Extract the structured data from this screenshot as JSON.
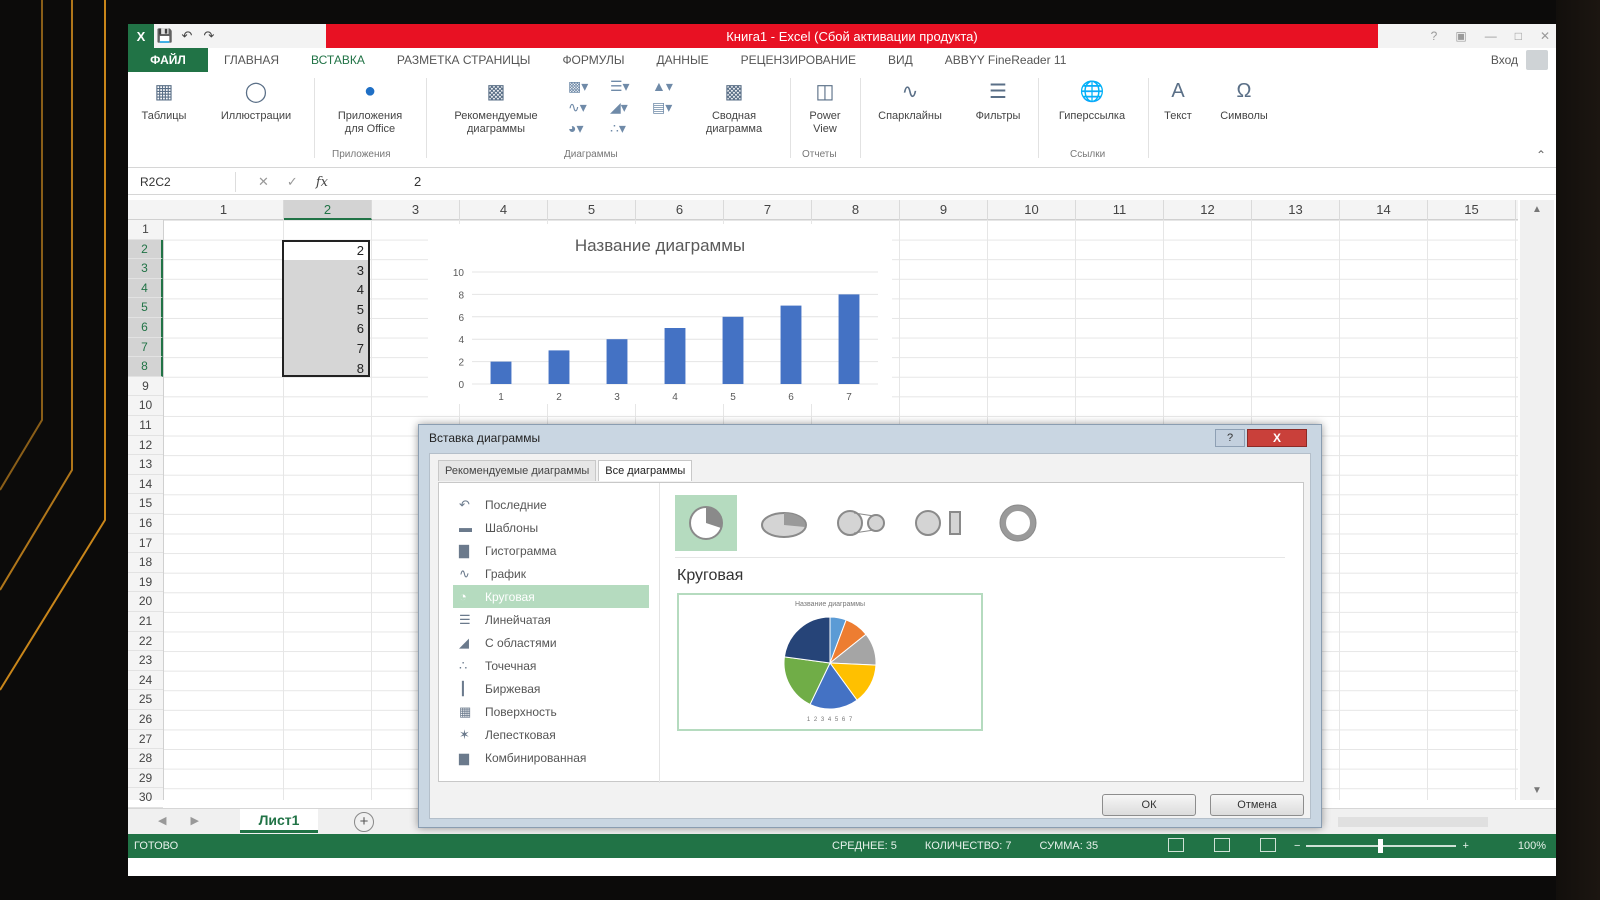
{
  "window": {
    "title": "Книга1 - Excel (Сбой активации продукта)",
    "app_icon": "X"
  },
  "ribbon_tabs": [
    {
      "label": "ФАЙЛ"
    },
    {
      "label": "ГЛАВНАЯ"
    },
    {
      "label": "ВСТАВКА"
    },
    {
      "label": "РАЗМЕТКА СТРАНИЦЫ"
    },
    {
      "label": "ФОРМУЛЫ"
    },
    {
      "label": "ДАННЫЕ"
    },
    {
      "label": "РЕЦЕНЗИРОВАНИЕ"
    },
    {
      "label": "ВИД"
    },
    {
      "label": "ABBYY FineReader 11"
    }
  ],
  "signin": "Вход",
  "ribbon": {
    "tables": "Таблицы",
    "illustrations": "Иллюстрации",
    "apps": "Приложения\nдля Office",
    "recommended_charts": "Рекомендуемые\nдиаграммы",
    "pivot_chart": "Сводная\nдиаграмма",
    "power_view": "Power\nView",
    "sparklines": "Спарклайны",
    "filters": "Фильтры",
    "hyperlink": "Гиперссылка",
    "text": "Текст",
    "symbols": "Символы",
    "group_apps": "Приложения",
    "group_charts": "Диаграммы",
    "group_reports": "Отчеты",
    "group_links": "Ссылки"
  },
  "formula_bar": {
    "name_box": "R2C2",
    "fx": "fx",
    "value": "2"
  },
  "columns": [
    "1",
    "2",
    "3",
    "4",
    "5",
    "6",
    "7",
    "8",
    "9",
    "10",
    "11",
    "12",
    "13",
    "14",
    "15"
  ],
  "rows": [
    "1",
    "2",
    "3",
    "4",
    "5",
    "6",
    "7",
    "8",
    "9",
    "10",
    "11",
    "12",
    "13",
    "14",
    "15",
    "16",
    "17",
    "18",
    "19",
    "20",
    "21",
    "22",
    "23",
    "24",
    "25",
    "26",
    "27",
    "28",
    "29",
    "30"
  ],
  "cell_values": [
    "2",
    "3",
    "4",
    "5",
    "6",
    "7",
    "8"
  ],
  "chart_data": {
    "type": "bar",
    "title": "Название диаграммы",
    "categories": [
      "1",
      "2",
      "3",
      "4",
      "5",
      "6",
      "7"
    ],
    "values": [
      2,
      3,
      4,
      5,
      6,
      7,
      8
    ],
    "ylim": [
      0,
      10
    ],
    "yticks": [
      "0",
      "2",
      "4",
      "6",
      "8",
      "10"
    ],
    "bar_color": "#4472c4",
    "grid": true
  },
  "sheet_tab": "Лист1",
  "status": {
    "ready": "ГОТОВО",
    "average": "СРЕДНЕЕ: 5",
    "count": "КОЛИЧЕСТВО: 7",
    "sum": "СУММА: 35",
    "zoom": "100%"
  },
  "dialog": {
    "title": "Вставка диаграммы",
    "help": "?",
    "close": "X",
    "tabs": [
      "Рекомендуемые диаграммы",
      "Все диаграммы"
    ],
    "chart_types": [
      {
        "label": "Последние",
        "icon": "recent-icon"
      },
      {
        "label": "Шаблоны",
        "icon": "folder-icon"
      },
      {
        "label": "Гистограмма",
        "icon": "column-chart-icon"
      },
      {
        "label": "График",
        "icon": "line-chart-icon"
      },
      {
        "label": "Круговая",
        "icon": "pie-chart-icon"
      },
      {
        "label": "Линейчатая",
        "icon": "bar-chart-icon"
      },
      {
        "label": "С областями",
        "icon": "area-chart-icon"
      },
      {
        "label": "Точечная",
        "icon": "scatter-chart-icon"
      },
      {
        "label": "Биржевая",
        "icon": "stock-chart-icon"
      },
      {
        "label": "Поверхность",
        "icon": "surface-chart-icon"
      },
      {
        "label": "Лепестковая",
        "icon": "radar-chart-icon"
      },
      {
        "label": "Комбинированная",
        "icon": "combo-chart-icon"
      }
    ],
    "selected_index": 4,
    "selected_title": "Круговая",
    "preview_title": "Название диаграммы",
    "preview_legend": "1 2 3 4 5 6 7",
    "ok": "ОК",
    "cancel": "Отмена",
    "pie_colors": [
      "#5b9bd5",
      "#ed7d31",
      "#a5a5a5",
      "#ffc000",
      "#4472c4",
      "#70ad47",
      "#264478"
    ]
  }
}
